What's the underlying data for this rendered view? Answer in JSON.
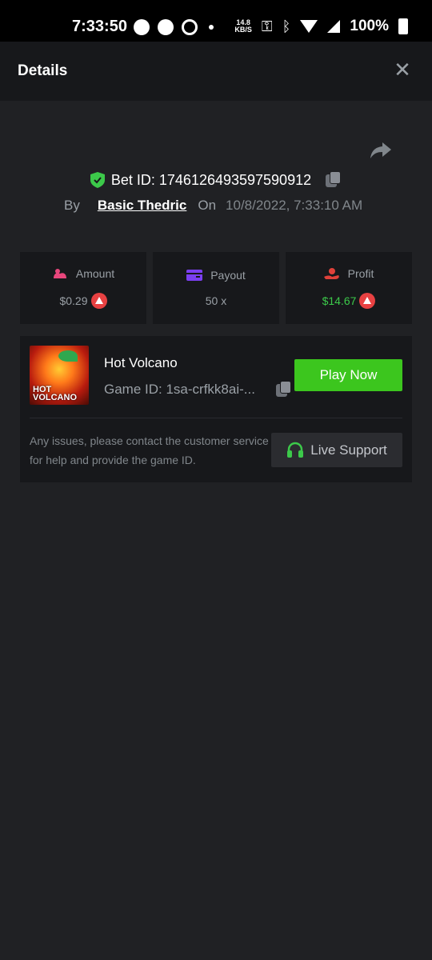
{
  "status_bar": {
    "time": "7:33:50",
    "net_speed_value": "14.8",
    "net_speed_unit": "KB/S",
    "battery": "100%"
  },
  "header": {
    "title": "Details",
    "close_icon": "close-icon"
  },
  "bet": {
    "label": "Bet ID: 1746126493597590912",
    "by_label": "By",
    "user": "Basic Thedric",
    "on_label": "On",
    "date": "10/8/2022, 7:33:10 AM"
  },
  "stats": {
    "amount_label": "Amount",
    "amount_value": "$0.29",
    "payout_label": "Payout",
    "payout_value": "50 x",
    "profit_label": "Profit",
    "profit_value": "$14.67"
  },
  "game": {
    "thumb_text_line1": "HOT",
    "thumb_text_line2": "VOLCANO",
    "name": "Hot Volcano",
    "id_text": "Game ID: 1sa-crfkk8ai-...",
    "play_label": "Play Now",
    "issue_text": "Any issues, please contact the customer service for help and provide the game ID.",
    "support_label": "Live Support"
  },
  "colors": {
    "accent_green": "#3cc61e",
    "profit_green": "#3cc94a",
    "coin_red": "#e84142",
    "amount_pink": "#e8467c",
    "payout_purple": "#7b3ff2",
    "profit_red": "#e0413a"
  }
}
